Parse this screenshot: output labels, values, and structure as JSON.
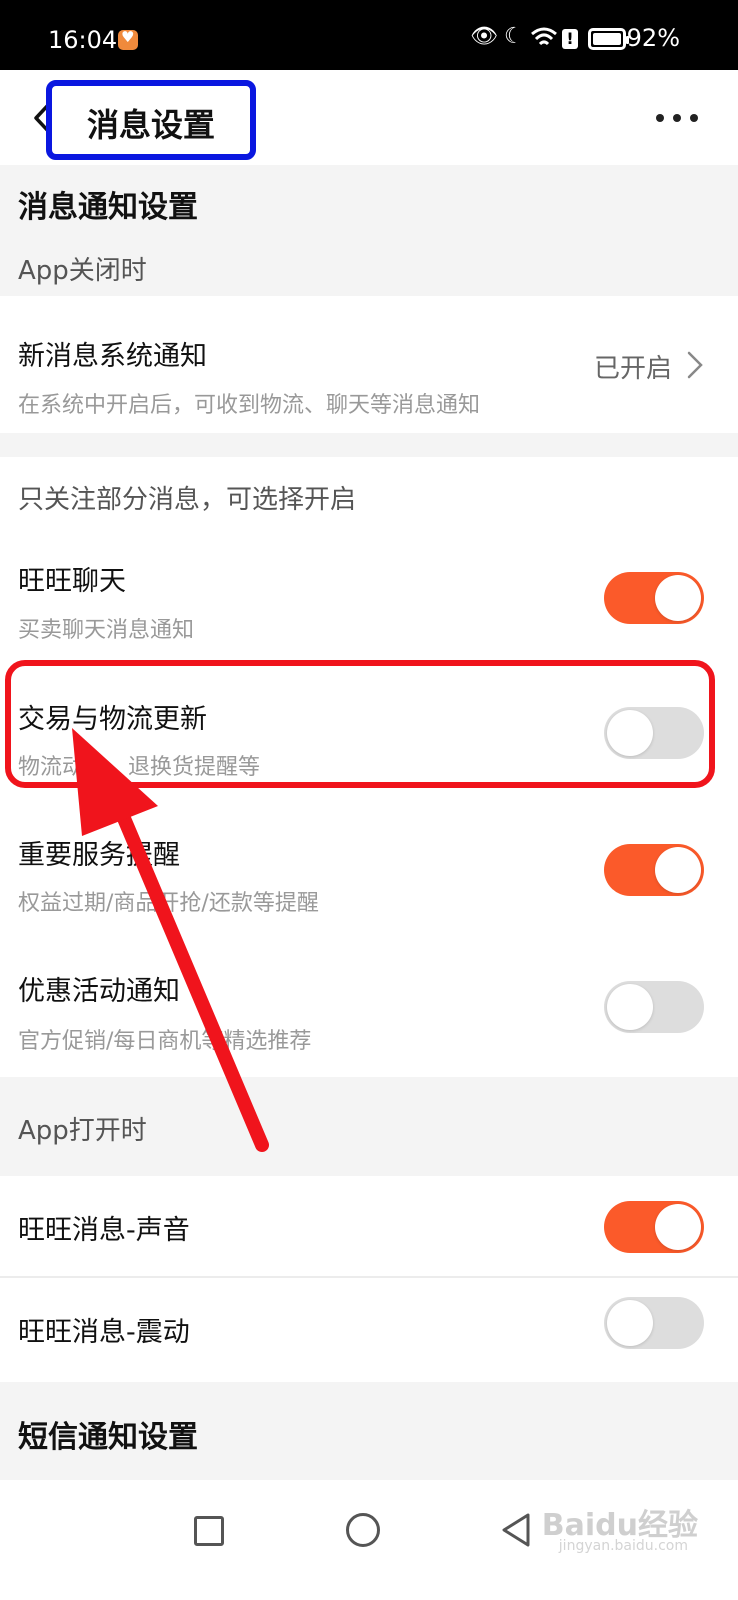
{
  "status_bar": {
    "time": "16:04",
    "battery": "92%"
  },
  "header": {
    "title": "消息设置"
  },
  "notification_section": {
    "title": "消息通知设置",
    "app_closed_label": "App关闭时",
    "system_notify": {
      "title": "新消息系统通知",
      "subtitle": "在系统中开启后，可收到物流、聊天等消息通知",
      "value": "已开启"
    },
    "partial_label": "只关注部分消息，可选择开启",
    "items": [
      {
        "title": "旺旺聊天",
        "subtitle": "买卖聊天消息通知",
        "enabled": true
      },
      {
        "title": "交易与物流更新",
        "subtitle": "物流动态、退换货提醒等",
        "enabled": false
      },
      {
        "title": "重要服务提醒",
        "subtitle": "权益过期/商品开抢/还款等提醒",
        "enabled": true
      },
      {
        "title": "优惠活动通知",
        "subtitle": "官方促销/每日商机等精选推荐",
        "enabled": false
      }
    ],
    "app_open_label": "App打开时",
    "open_items": [
      {
        "title": "旺旺消息-声音",
        "enabled": true
      },
      {
        "title": "旺旺消息-震动",
        "enabled": false
      }
    ]
  },
  "sms_section": {
    "title": "短信通知设置"
  },
  "watermark": {
    "brand": "Baidu经验",
    "url": "jingyan.baidu.com"
  },
  "colors": {
    "toggle_on": "#fb5a2a",
    "toggle_off": "#dddddd",
    "highlight_box": "#f0141c",
    "title_box": "#0a17e0"
  },
  "icons": {
    "back": "chevron-left-icon",
    "more": "more-dots-icon",
    "nav_square": "recent-apps-icon",
    "nav_circle": "home-icon",
    "nav_triangle": "nav-back-icon"
  }
}
